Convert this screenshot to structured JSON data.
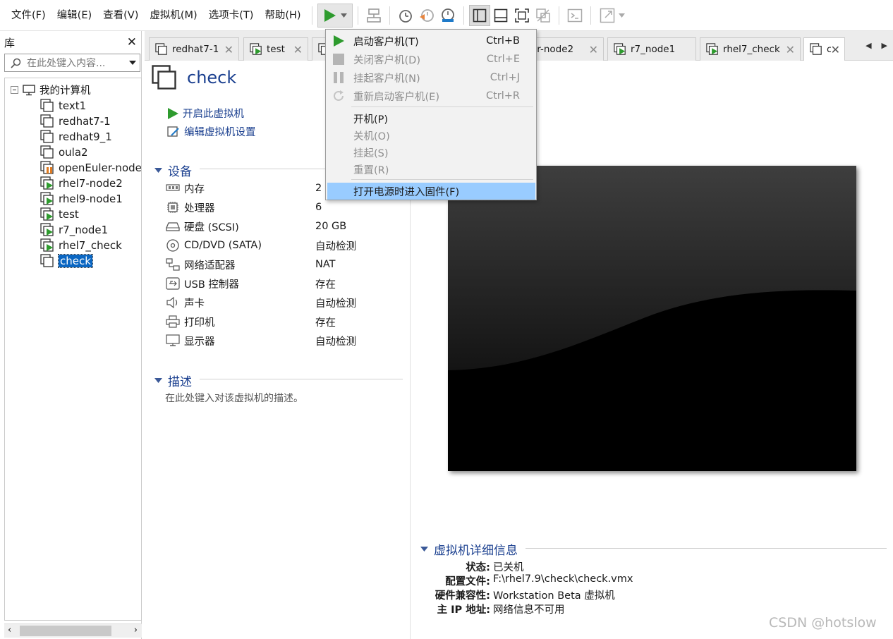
{
  "menubar": {
    "items": [
      "文件(F)",
      "编辑(E)",
      "查看(V)",
      "虚拟机(M)",
      "选项卡(T)",
      "帮助(H)"
    ]
  },
  "library": {
    "title": "库",
    "search_placeholder": "在此处键入内容...",
    "root": "我的计算机",
    "items": [
      "text1",
      "redhat7-1",
      "redhat9_1",
      "oula2",
      "openEuler-node",
      "rhel7-node2",
      "rhel9-node1",
      "test",
      "r7_node1",
      "rhel7_check",
      "check"
    ],
    "selected": "check"
  },
  "tabs": [
    "redhat7-1",
    "test",
    "er-node2",
    "r7_node1",
    "rhel7_check",
    "c"
  ],
  "vm": {
    "name": "check",
    "actions": {
      "start": "开启此虚拟机",
      "edit": "编辑虚拟机设置"
    },
    "devices_title": "设备",
    "devices": [
      {
        "name": "内存",
        "value": "2"
      },
      {
        "name": "处理器",
        "value": "6"
      },
      {
        "name": "硬盘 (SCSI)",
        "value": "20 GB"
      },
      {
        "name": "CD/DVD (SATA)",
        "value": "自动检测"
      },
      {
        "name": "网络适配器",
        "value": "NAT"
      },
      {
        "name": "USB 控制器",
        "value": "存在"
      },
      {
        "name": "声卡",
        "value": "自动检测"
      },
      {
        "name": "打印机",
        "value": "存在"
      },
      {
        "name": "显示器",
        "value": "自动检测"
      }
    ],
    "description_title": "描述",
    "description_hint": "在此处键入对该虚拟机的描述。"
  },
  "details": {
    "title": "虚拟机详细信息",
    "rows": [
      {
        "k": "状态:",
        "v": "已关机"
      },
      {
        "k": "配置文件:",
        "v": "F:\\rhel7.9\\check\\check.vmx"
      },
      {
        "k": "硬件兼容性:",
        "v": "Workstation Beta 虚拟机"
      },
      {
        "k": "主 IP 地址:",
        "v": "网络信息不可用"
      }
    ]
  },
  "power_menu": {
    "items": [
      {
        "label": "启动客户机(T)",
        "shortcut": "Ctrl+B",
        "enabled": true
      },
      {
        "label": "关闭客户机(D)",
        "shortcut": "Ctrl+E",
        "enabled": false
      },
      {
        "label": "挂起客户机(N)",
        "shortcut": "Ctrl+J",
        "enabled": false
      },
      {
        "label": "重新启动客户机(E)",
        "shortcut": "Ctrl+R",
        "enabled": false
      },
      {
        "label": "开机(P)",
        "shortcut": "",
        "enabled": true
      },
      {
        "label": "关机(O)",
        "shortcut": "",
        "enabled": false
      },
      {
        "label": "挂起(S)",
        "shortcut": "",
        "enabled": false
      },
      {
        "label": "重置(R)",
        "shortcut": "",
        "enabled": false
      },
      {
        "label": "打开电源时进入固件(F)",
        "shortcut": "",
        "enabled": true,
        "highlighted": true
      }
    ]
  },
  "watermark": "CSDN @hotslow",
  "colors": {
    "accent": "#1a3f8f",
    "play_green": "#2e9b2e",
    "selection": "#0a66c2",
    "menu_highlight": "#99ccff"
  }
}
